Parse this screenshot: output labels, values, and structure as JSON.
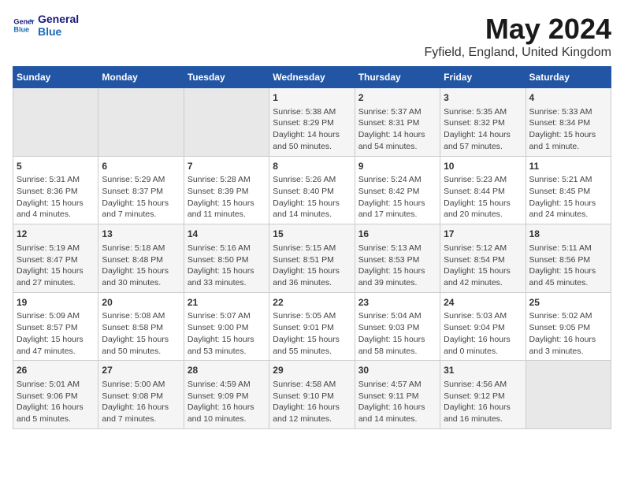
{
  "logo": {
    "line1": "General",
    "line2": "Blue"
  },
  "title": "May 2024",
  "subtitle": "Fyfield, England, United Kingdom",
  "headers": [
    "Sunday",
    "Monday",
    "Tuesday",
    "Wednesday",
    "Thursday",
    "Friday",
    "Saturday"
  ],
  "weeks": [
    [
      {
        "day": "",
        "info": ""
      },
      {
        "day": "",
        "info": ""
      },
      {
        "day": "",
        "info": ""
      },
      {
        "day": "1",
        "info": "Sunrise: 5:38 AM\nSunset: 8:29 PM\nDaylight: 14 hours\nand 50 minutes."
      },
      {
        "day": "2",
        "info": "Sunrise: 5:37 AM\nSunset: 8:31 PM\nDaylight: 14 hours\nand 54 minutes."
      },
      {
        "day": "3",
        "info": "Sunrise: 5:35 AM\nSunset: 8:32 PM\nDaylight: 14 hours\nand 57 minutes."
      },
      {
        "day": "4",
        "info": "Sunrise: 5:33 AM\nSunset: 8:34 PM\nDaylight: 15 hours\nand 1 minute."
      }
    ],
    [
      {
        "day": "5",
        "info": "Sunrise: 5:31 AM\nSunset: 8:36 PM\nDaylight: 15 hours\nand 4 minutes."
      },
      {
        "day": "6",
        "info": "Sunrise: 5:29 AM\nSunset: 8:37 PM\nDaylight: 15 hours\nand 7 minutes."
      },
      {
        "day": "7",
        "info": "Sunrise: 5:28 AM\nSunset: 8:39 PM\nDaylight: 15 hours\nand 11 minutes."
      },
      {
        "day": "8",
        "info": "Sunrise: 5:26 AM\nSunset: 8:40 PM\nDaylight: 15 hours\nand 14 minutes."
      },
      {
        "day": "9",
        "info": "Sunrise: 5:24 AM\nSunset: 8:42 PM\nDaylight: 15 hours\nand 17 minutes."
      },
      {
        "day": "10",
        "info": "Sunrise: 5:23 AM\nSunset: 8:44 PM\nDaylight: 15 hours\nand 20 minutes."
      },
      {
        "day": "11",
        "info": "Sunrise: 5:21 AM\nSunset: 8:45 PM\nDaylight: 15 hours\nand 24 minutes."
      }
    ],
    [
      {
        "day": "12",
        "info": "Sunrise: 5:19 AM\nSunset: 8:47 PM\nDaylight: 15 hours\nand 27 minutes."
      },
      {
        "day": "13",
        "info": "Sunrise: 5:18 AM\nSunset: 8:48 PM\nDaylight: 15 hours\nand 30 minutes."
      },
      {
        "day": "14",
        "info": "Sunrise: 5:16 AM\nSunset: 8:50 PM\nDaylight: 15 hours\nand 33 minutes."
      },
      {
        "day": "15",
        "info": "Sunrise: 5:15 AM\nSunset: 8:51 PM\nDaylight: 15 hours\nand 36 minutes."
      },
      {
        "day": "16",
        "info": "Sunrise: 5:13 AM\nSunset: 8:53 PM\nDaylight: 15 hours\nand 39 minutes."
      },
      {
        "day": "17",
        "info": "Sunrise: 5:12 AM\nSunset: 8:54 PM\nDaylight: 15 hours\nand 42 minutes."
      },
      {
        "day": "18",
        "info": "Sunrise: 5:11 AM\nSunset: 8:56 PM\nDaylight: 15 hours\nand 45 minutes."
      }
    ],
    [
      {
        "day": "19",
        "info": "Sunrise: 5:09 AM\nSunset: 8:57 PM\nDaylight: 15 hours\nand 47 minutes."
      },
      {
        "day": "20",
        "info": "Sunrise: 5:08 AM\nSunset: 8:58 PM\nDaylight: 15 hours\nand 50 minutes."
      },
      {
        "day": "21",
        "info": "Sunrise: 5:07 AM\nSunset: 9:00 PM\nDaylight: 15 hours\nand 53 minutes."
      },
      {
        "day": "22",
        "info": "Sunrise: 5:05 AM\nSunset: 9:01 PM\nDaylight: 15 hours\nand 55 minutes."
      },
      {
        "day": "23",
        "info": "Sunrise: 5:04 AM\nSunset: 9:03 PM\nDaylight: 15 hours\nand 58 minutes."
      },
      {
        "day": "24",
        "info": "Sunrise: 5:03 AM\nSunset: 9:04 PM\nDaylight: 16 hours\nand 0 minutes."
      },
      {
        "day": "25",
        "info": "Sunrise: 5:02 AM\nSunset: 9:05 PM\nDaylight: 16 hours\nand 3 minutes."
      }
    ],
    [
      {
        "day": "26",
        "info": "Sunrise: 5:01 AM\nSunset: 9:06 PM\nDaylight: 16 hours\nand 5 minutes."
      },
      {
        "day": "27",
        "info": "Sunrise: 5:00 AM\nSunset: 9:08 PM\nDaylight: 16 hours\nand 7 minutes."
      },
      {
        "day": "28",
        "info": "Sunrise: 4:59 AM\nSunset: 9:09 PM\nDaylight: 16 hours\nand 10 minutes."
      },
      {
        "day": "29",
        "info": "Sunrise: 4:58 AM\nSunset: 9:10 PM\nDaylight: 16 hours\nand 12 minutes."
      },
      {
        "day": "30",
        "info": "Sunrise: 4:57 AM\nSunset: 9:11 PM\nDaylight: 16 hours\nand 14 minutes."
      },
      {
        "day": "31",
        "info": "Sunrise: 4:56 AM\nSunset: 9:12 PM\nDaylight: 16 hours\nand 16 minutes."
      },
      {
        "day": "",
        "info": ""
      }
    ]
  ]
}
